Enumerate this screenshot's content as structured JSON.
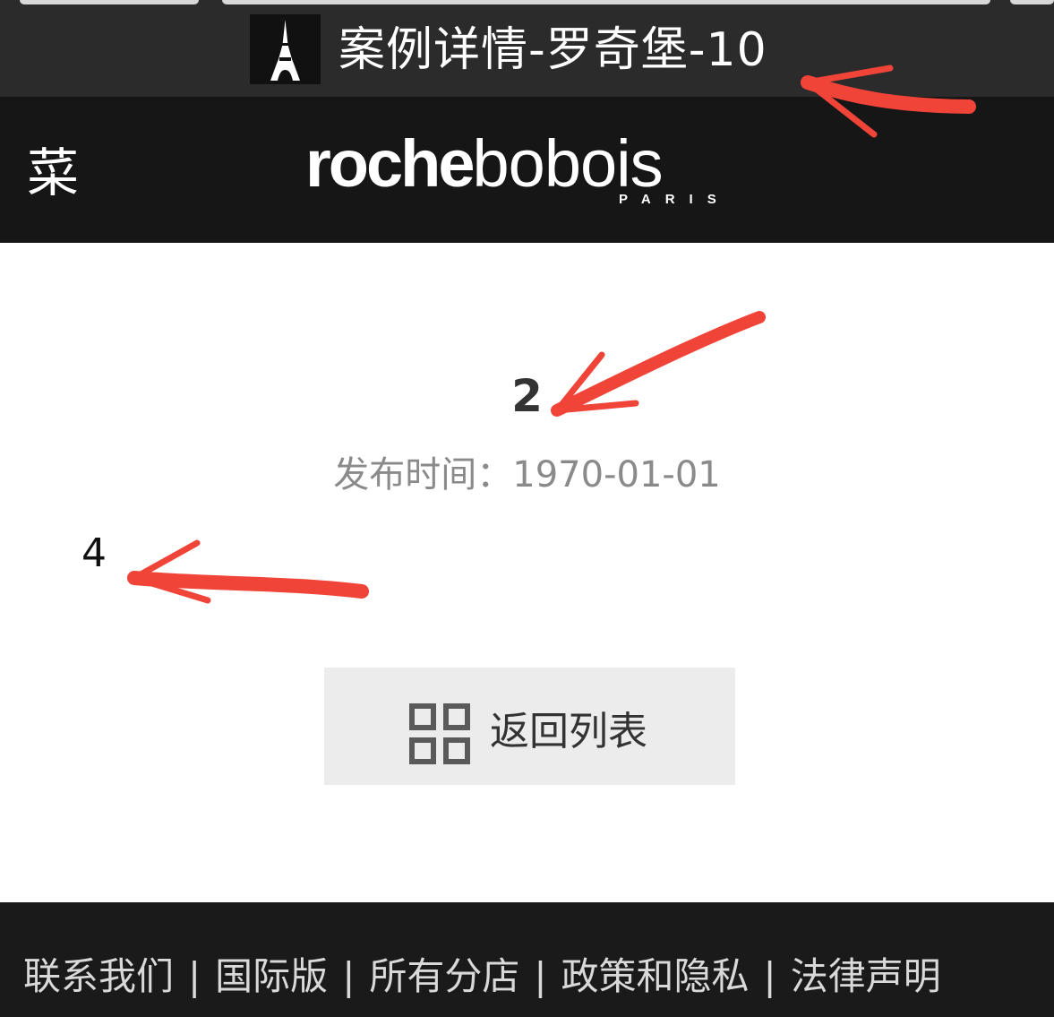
{
  "browser": {
    "tab_title": "案例详情-罗奇堡-10",
    "favicon": "eiffel-tower-icon"
  },
  "header": {
    "menu_label": "菜",
    "logo": {
      "bold_part": "roche",
      "light_part": "bobois",
      "sub": "PARIS"
    }
  },
  "main": {
    "title": "2",
    "publish_label": "发布时间：",
    "publish_date": "1970-01-01",
    "body": "4",
    "back_button": {
      "label": "返回列表",
      "icon": "grid-icon"
    }
  },
  "footer": {
    "links": [
      {
        "label": "联系我们"
      },
      {
        "label": "国际版"
      },
      {
        "label": "所有分店"
      },
      {
        "label": "政策和隐私"
      },
      {
        "label": "法律声明"
      }
    ],
    "separator": "|"
  },
  "annotation": {
    "arrow_color": "#f04438"
  },
  "colors": {
    "header_bg": "#161616",
    "tabbar_bg": "#2b2b2b",
    "footer_bg": "#1a1a1a",
    "button_bg": "#ececec"
  }
}
